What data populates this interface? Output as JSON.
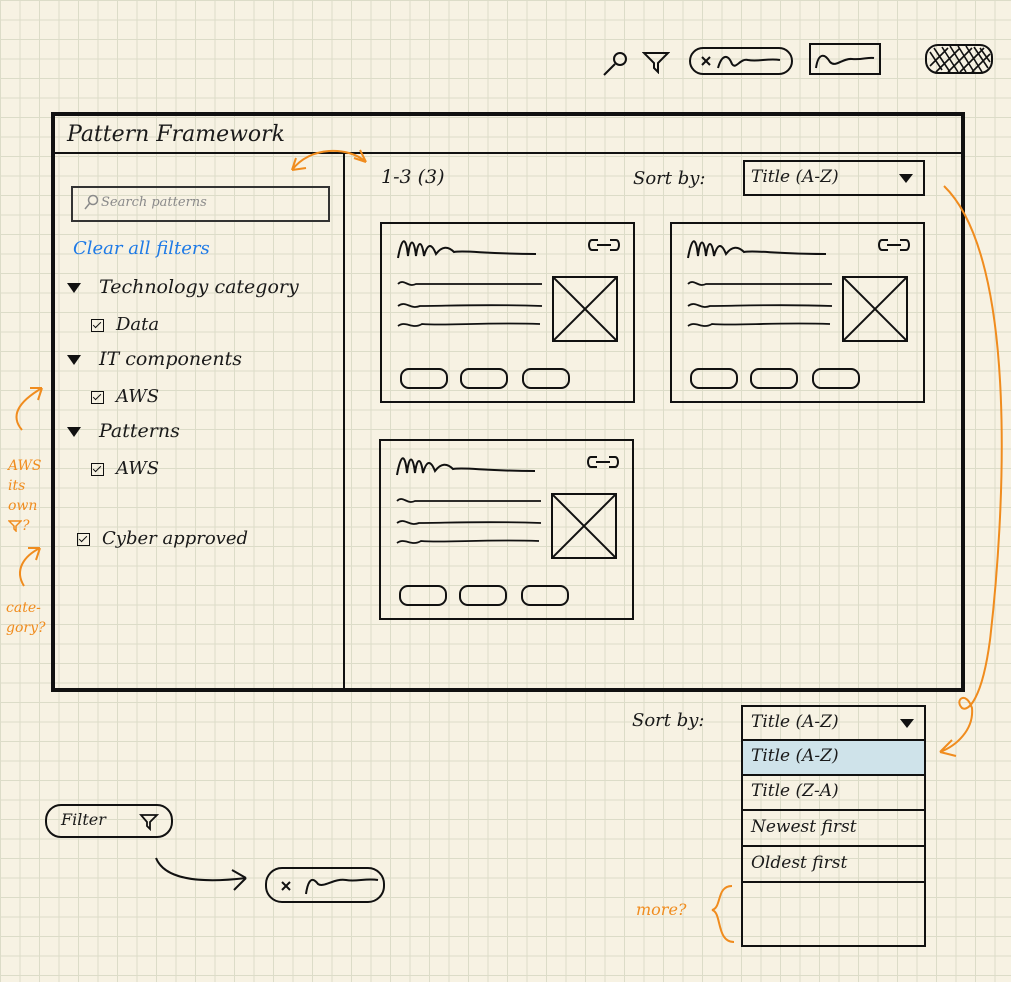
{
  "app": {
    "title": "Pattern Framework"
  },
  "sidebar": {
    "search_placeholder": "Search patterns",
    "clear_filters": "Clear all filters",
    "categories": [
      {
        "label": "Technology category",
        "option": "Data"
      },
      {
        "label": "IT components",
        "option": "AWS"
      },
      {
        "label": "Patterns",
        "option": "AWS"
      }
    ],
    "cyber_option": "Cyber approved"
  },
  "results": {
    "count": "1-3 (3)",
    "sort_label": "Sort by:",
    "sort_value": "Title (A-Z)"
  },
  "sort_dropdown": {
    "label": "Sort by:",
    "current": "Title (A-Z)",
    "options": [
      "Title (A-Z)",
      "Title (Z-A)",
      "Newest first",
      "Oldest first"
    ]
  },
  "filter_chip": {
    "label": "Filter"
  },
  "annotations": {
    "aws_note": [
      "AWS",
      "its",
      "own",
      "?"
    ],
    "category_note": [
      "cate-",
      "gory?"
    ],
    "more_note": "more?"
  },
  "icons": [
    "search-icon",
    "filter-icon",
    "link-icon",
    "image-placeholder-icon",
    "chevron-down-icon",
    "close-icon"
  ],
  "colors": {
    "ink": "#1a1a1a",
    "annotation": "#f08c1e",
    "link": "#1e7ae6",
    "selected": "#cfe3ea",
    "paper": "#f7f2e3"
  }
}
